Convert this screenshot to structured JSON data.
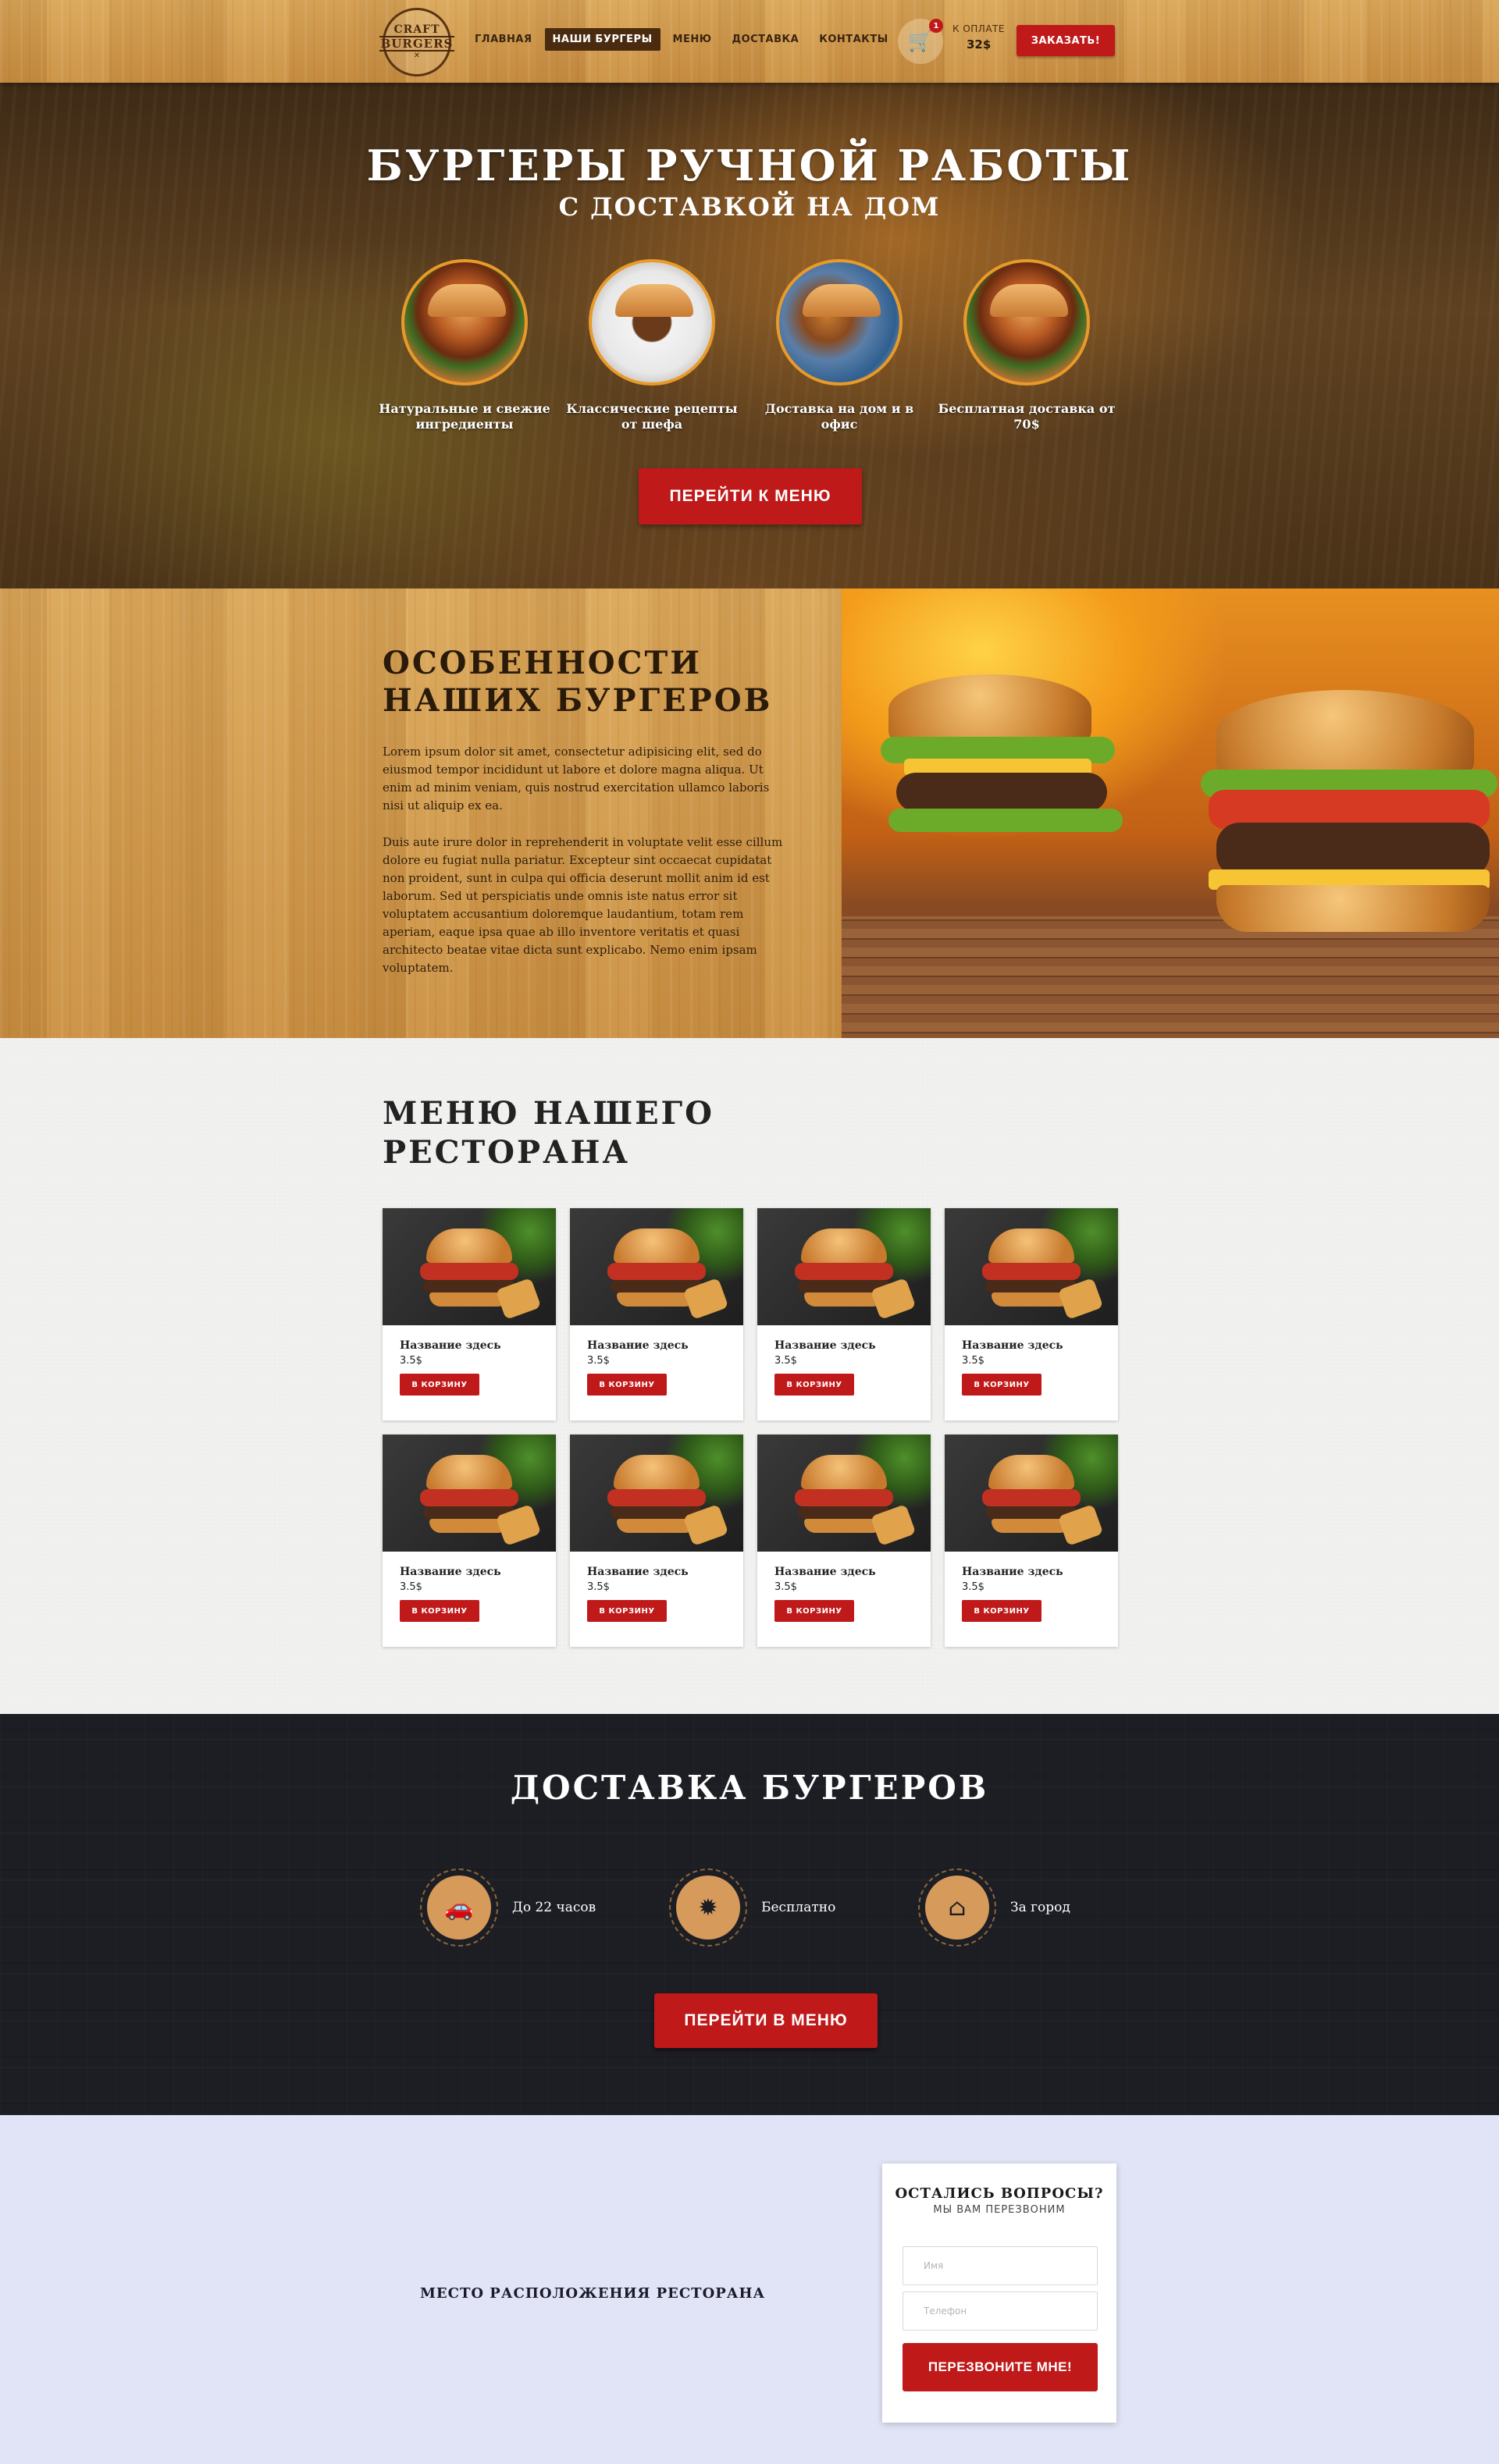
{
  "header": {
    "logo": {
      "line1": "CRAFT",
      "line2": "BURGERS"
    },
    "nav": [
      {
        "label": "Главная"
      },
      {
        "label": "Наши бургеры"
      },
      {
        "label": "Меню"
      },
      {
        "label": "Доставка"
      },
      {
        "label": "Контакты"
      }
    ],
    "cart_icon": "shopping-cart-icon",
    "cart_count": "1",
    "pay_label": "К оплате",
    "pay_amount": "32$",
    "order_button": "Заказать!"
  },
  "hero": {
    "title": "Бургеры ручной работы",
    "subtitle": "с доставкой на дом",
    "features": [
      {
        "caption": "Натуральные и свежие ингредиенты"
      },
      {
        "caption": "Классические рецепты от шефа"
      },
      {
        "caption": "Доставка на дом и в офис"
      },
      {
        "caption": "Бесплатная доставка от 70$"
      }
    ],
    "button": "Перейти к меню"
  },
  "about": {
    "title_line1": "Особенности",
    "title_line2": "наших бургеров",
    "paragraph1": "Lorem ipsum dolor sit amet, consectetur adipisicing elit, sed do eiusmod tempor incididunt ut labore et dolore magna aliqua. Ut enim ad minim veniam, quis nostrud exercitation ullamco laboris nisi ut aliquip ex ea.",
    "paragraph2": "Duis aute irure dolor in reprehenderit in voluptate velit esse cillum dolore eu fugiat nulla pariatur. Excepteur sint occaecat cupidatat non proident, sunt in culpa qui officia deserunt mollit anim id est laborum. Sed ut perspiciatis unde omnis iste natus error sit voluptatem accusantium doloremque laudantium, totam rem aperiam, eaque ipsa quae ab illo inventore veritatis et quasi architecto beatae vitae dicta sunt explicabo. Nemo enim ipsam voluptatem."
  },
  "menu": {
    "title_line1": "Меню нашего",
    "title_line2": "ресторана",
    "items": [
      {
        "name": "Название здесь",
        "price": "3.5$",
        "button": "В корзину"
      },
      {
        "name": "Название здесь",
        "price": "3.5$",
        "button": "В корзину"
      },
      {
        "name": "Название здесь",
        "price": "3.5$",
        "button": "В корзину"
      },
      {
        "name": "Название здесь",
        "price": "3.5$",
        "button": "В корзину"
      },
      {
        "name": "Название здесь",
        "price": "3.5$",
        "button": "В корзину"
      },
      {
        "name": "Название здесь",
        "price": "3.5$",
        "button": "В корзину"
      },
      {
        "name": "Название здесь",
        "price": "3.5$",
        "button": "В корзину"
      },
      {
        "name": "Название здесь",
        "price": "3.5$",
        "button": "В корзину"
      }
    ]
  },
  "delivery": {
    "title": "Доставка бургеров",
    "features": [
      {
        "icon": "car-icon",
        "label": "До 22 часов"
      },
      {
        "icon": "badge-icon",
        "label": "Бесплатно"
      },
      {
        "icon": "home-icon",
        "label": "За город"
      }
    ],
    "button": "Перейти в меню"
  },
  "contact": {
    "location_label": "Место расположения ресторана",
    "form": {
      "title": "Остались вопросы?",
      "subtitle": "Мы вам перезвоним",
      "name_placeholder": "Имя",
      "phone_placeholder": "Телефон",
      "button": "Перезвоните мне!"
    }
  },
  "colors": {
    "accent": "#c0191a",
    "dark": "#1d1e24",
    "wood": "#d49e52",
    "contact_bg": "#e1e4f6"
  }
}
